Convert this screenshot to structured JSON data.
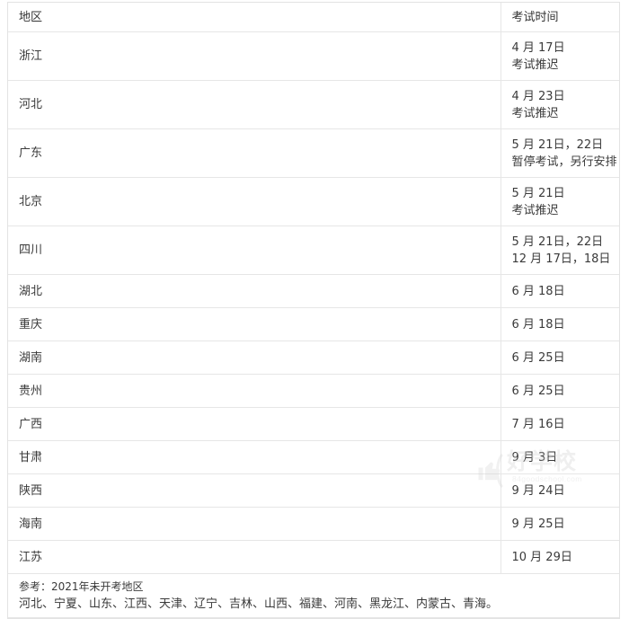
{
  "table": {
    "columns": [
      "地区",
      "考试时间"
    ],
    "rows": [
      {
        "region": "浙江",
        "dates": [
          "4 月 17日",
          "考试推迟"
        ]
      },
      {
        "region": "河北",
        "dates": [
          "4 月 23日",
          "考试推迟"
        ]
      },
      {
        "region": "广东",
        "dates": [
          "5 月 21日，22日",
          "暂停考试，另行安排"
        ]
      },
      {
        "region": "北京",
        "dates": [
          "5 月 21日",
          "考试推迟"
        ]
      },
      {
        "region": "四川",
        "dates": [
          "5 月 21日，22日",
          "12 月 17日，18日"
        ]
      },
      {
        "region": "湖北",
        "dates": [
          "6 月 18日"
        ]
      },
      {
        "region": "重庆",
        "dates": [
          "6 月 18日"
        ]
      },
      {
        "region": "湖南",
        "dates": [
          "6 月 25日"
        ]
      },
      {
        "region": "贵州",
        "dates": [
          "6 月 25日"
        ]
      },
      {
        "region": "广西",
        "dates": [
          "7 月 16日"
        ]
      },
      {
        "region": "甘肃",
        "dates": [
          "9 月 3日"
        ]
      },
      {
        "region": "陕西",
        "dates": [
          "9 月 24日"
        ]
      },
      {
        "region": "海南",
        "dates": [
          "9 月 25日"
        ]
      },
      {
        "region": "江苏",
        "dates": [
          "10 月 29日"
        ]
      }
    ],
    "footnote": {
      "line1": "参考：2021年未开考地区",
      "line2": "河北、宁夏、山东、江西、天津、辽宁、吉林、山西、福建、河南、黑龙江、内蒙古、青海。"
    }
  },
  "watermark": {
    "brand": "好学校",
    "url": "84goodschool.com"
  },
  "colors": {
    "border": "#e6e6e6",
    "text": "#3a3a3a",
    "background": "#ffffff",
    "watermark": "#d4d4d4"
  }
}
